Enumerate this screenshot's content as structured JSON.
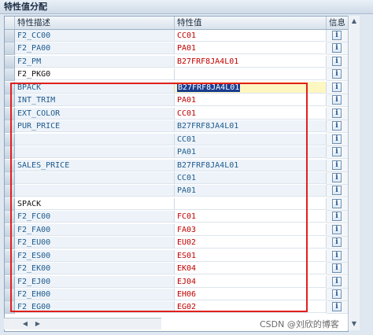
{
  "panel": {
    "title": "特性值分配"
  },
  "headers": {
    "description": "特性描述",
    "value": "特性值",
    "info": "信息"
  },
  "rows": [
    {
      "desc": "F2_CC00",
      "value": "CC01",
      "style": "red"
    },
    {
      "desc": "F2_PA00",
      "value": "PA01",
      "style": "red"
    },
    {
      "desc": "F2_PM",
      "value": "B27FRF8JA4L01",
      "style": "red"
    },
    {
      "desc": "F2_PKG0",
      "value": "",
      "style": "red",
      "desc_style": "hl"
    },
    {
      "desc": "BPACK",
      "value": "B27FRF8JA4L01",
      "style": "input"
    },
    {
      "desc": "INT_TRIM",
      "value": "PA01",
      "style": "red"
    },
    {
      "desc": "EXT_COLOR",
      "value": "CC01",
      "style": "red"
    },
    {
      "desc": "PUR_PRICE",
      "value": "B27FRF8JA4L01",
      "style": "blue"
    },
    {
      "desc": "",
      "value": "CC01",
      "style": "blue"
    },
    {
      "desc": "",
      "value": "PA01",
      "style": "blue"
    },
    {
      "desc": "SALES_PRICE",
      "value": "B27FRF8JA4L01",
      "style": "blue"
    },
    {
      "desc": "",
      "value": "CC01",
      "style": "blue"
    },
    {
      "desc": "",
      "value": "PA01",
      "style": "blue"
    },
    {
      "desc": "SPACK",
      "value": "",
      "style": "red",
      "desc_style": "hl"
    },
    {
      "desc": "F2_FC00",
      "value": "FC01",
      "style": "red"
    },
    {
      "desc": "F2_FA00",
      "value": "FA03",
      "style": "red"
    },
    {
      "desc": "F2_EU00",
      "value": "EU02",
      "style": "red"
    },
    {
      "desc": "F2_ES00",
      "value": "ES01",
      "style": "red"
    },
    {
      "desc": "F2_EK00",
      "value": "EK04",
      "style": "red"
    },
    {
      "desc": "F2_EJ00",
      "value": "EJ04",
      "style": "red"
    },
    {
      "desc": "F2_EH00",
      "value": "EH06",
      "style": "red"
    },
    {
      "desc": "F2_EG00",
      "value": "EG02",
      "style": "red"
    }
  ],
  "info_icon": "info-icon",
  "watermark": "CSDN @刘欣的博客"
}
